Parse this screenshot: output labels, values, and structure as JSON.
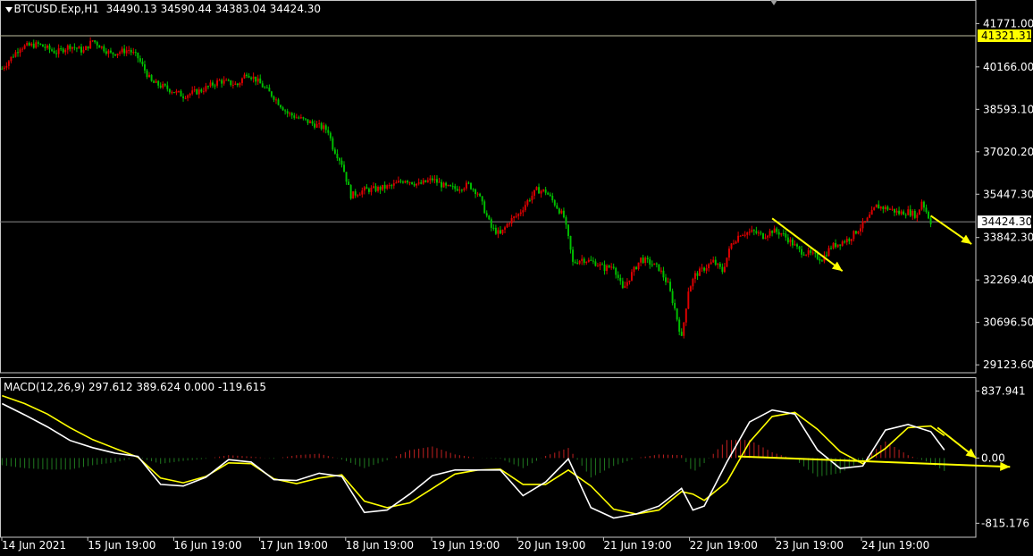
{
  "header": {
    "symbol": "BTCUSD.Exp,H1",
    "ohlc": "34490.13 34590.44 34383.04 34424.30"
  },
  "indicator": {
    "label": "MACD(12,26,9) 297.612 389.624 0.000 -119.615"
  },
  "colors": {
    "background": "#000000",
    "bull": "#00c000",
    "bear": "#e00000",
    "arrow": "#ffff00",
    "signal": "#ffff00",
    "macd": "#ffffff",
    "hist_pos": "#c02020",
    "hist_neg": "#207a20",
    "price_tag": "#ffff00"
  },
  "chart_data": [
    {
      "type": "candlestick",
      "symbol": "BTCUSD.Exp",
      "timeframe": "H1",
      "y_ticks": [
        41771.0,
        40166.0,
        38593.1,
        37020.2,
        35447.3,
        33842.3,
        32269.4,
        30696.5,
        29123.6
      ],
      "ylim": [
        28830,
        41950
      ],
      "price_labels": [
        "41321.31",
        "34424.30"
      ],
      "current_price": 34424.3,
      "upper_line": 41321.31,
      "x_tick_labels": [
        "14 Jun 2021",
        "15 Jun 19:00",
        "16 Jun 19:00",
        "17 Jun 19:00",
        "18 Jun 19:00",
        "19 Jun 19:00",
        "20 Jun 19:00",
        "21 Jun 19:00",
        "22 Jun 19:00",
        "23 Jun 19:00",
        "24 Jun 19:00"
      ],
      "close_path": [
        [
          0,
          40100
        ],
        [
          8,
          40900
        ],
        [
          16,
          41000
        ],
        [
          24,
          40700
        ],
        [
          30,
          40950
        ],
        [
          36,
          40750
        ],
        [
          40,
          41150
        ],
        [
          48,
          40650
        ],
        [
          56,
          40800
        ],
        [
          60,
          40500
        ],
        [
          66,
          39600
        ],
        [
          72,
          39400
        ],
        [
          80,
          39100
        ],
        [
          88,
          39300
        ],
        [
          96,
          39650
        ],
        [
          104,
          39500
        ],
        [
          108,
          39950
        ],
        [
          112,
          39700
        ],
        [
          120,
          39050
        ],
        [
          126,
          38450
        ],
        [
          130,
          38300
        ],
        [
          136,
          38100
        ],
        [
          142,
          37900
        ],
        [
          144,
          37800
        ],
        [
          146,
          37200
        ],
        [
          150,
          36600
        ],
        [
          154,
          35400
        ],
        [
          160,
          35600
        ],
        [
          166,
          35650
        ],
        [
          172,
          35750
        ],
        [
          178,
          36000
        ],
        [
          184,
          35800
        ],
        [
          190,
          36000
        ],
        [
          196,
          35700
        ],
        [
          200,
          35650
        ],
        [
          206,
          35800
        ],
        [
          210,
          35500
        ],
        [
          216,
          34200
        ],
        [
          220,
          33950
        ],
        [
          224,
          34450
        ],
        [
          228,
          34700
        ],
        [
          232,
          35200
        ],
        [
          236,
          35600
        ],
        [
          240,
          35550
        ],
        [
          244,
          35100
        ],
        [
          248,
          34600
        ],
        [
          250,
          33800
        ],
        [
          252,
          32900
        ],
        [
          256,
          33050
        ],
        [
          262,
          32900
        ],
        [
          266,
          32700
        ],
        [
          270,
          32800
        ],
        [
          274,
          31900
        ],
        [
          278,
          32500
        ],
        [
          282,
          33050
        ],
        [
          286,
          32900
        ],
        [
          290,
          32700
        ],
        [
          294,
          32100
        ],
        [
          297,
          31200
        ],
        [
          300,
          30100
        ],
        [
          303,
          31900
        ],
        [
          306,
          32450
        ],
        [
          310,
          32700
        ],
        [
          314,
          32950
        ],
        [
          318,
          32600
        ],
        [
          322,
          33600
        ],
        [
          326,
          34000
        ],
        [
          332,
          34050
        ],
        [
          336,
          33900
        ],
        [
          340,
          34100
        ],
        [
          344,
          34000
        ],
        [
          348,
          33700
        ],
        [
          352,
          33350
        ],
        [
          356,
          33250
        ],
        [
          362,
          33050
        ],
        [
          366,
          33500
        ],
        [
          370,
          33650
        ],
        [
          374,
          33800
        ],
        [
          378,
          34150
        ],
        [
          382,
          34500
        ],
        [
          386,
          35000
        ],
        [
          392,
          34900
        ],
        [
          396,
          34750
        ],
        [
          400,
          34800
        ],
        [
          404,
          34650
        ],
        [
          406,
          35200
        ],
        [
          410,
          34424.3
        ]
      ],
      "arrows": [
        {
          "from": [
            340,
            34550
          ],
          "to": [
            371,
            32600
          ]
        },
        {
          "from": [
            410,
            34650
          ],
          "to": [
            428,
            33600
          ]
        }
      ]
    },
    {
      "type": "macd",
      "params": [
        12,
        26,
        9
      ],
      "name": "MACD(12,26,9)",
      "values_shown": [
        297.612,
        389.624,
        0.0,
        -119.615
      ],
      "y_ticks": [
        837.941,
        0.0,
        -815.176
      ],
      "ylim": [
        -990,
        1010
      ],
      "macd": [
        [
          0,
          680
        ],
        [
          10,
          540
        ],
        [
          20,
          390
        ],
        [
          30,
          220
        ],
        [
          40,
          130
        ],
        [
          50,
          60
        ],
        [
          60,
          20
        ],
        [
          70,
          -330
        ],
        [
          80,
          -350
        ],
        [
          90,
          -240
        ],
        [
          100,
          -20
        ],
        [
          110,
          -50
        ],
        [
          120,
          -270
        ],
        [
          130,
          -280
        ],
        [
          140,
          -190
        ],
        [
          150,
          -230
        ],
        [
          160,
          -680
        ],
        [
          170,
          -650
        ],
        [
          180,
          -450
        ],
        [
          190,
          -220
        ],
        [
          200,
          -150
        ],
        [
          210,
          -150
        ],
        [
          220,
          -150
        ],
        [
          230,
          -470
        ],
        [
          240,
          -300
        ],
        [
          250,
          -10
        ],
        [
          260,
          -620
        ],
        [
          270,
          -750
        ],
        [
          280,
          -700
        ],
        [
          290,
          -600
        ],
        [
          300,
          -380
        ],
        [
          305,
          -650
        ],
        [
          310,
          -600
        ],
        [
          320,
          -50
        ],
        [
          330,
          450
        ],
        [
          340,
          600
        ],
        [
          350,
          550
        ],
        [
          360,
          100
        ],
        [
          370,
          -130
        ],
        [
          380,
          -100
        ],
        [
          390,
          350
        ],
        [
          400,
          420
        ],
        [
          410,
          330
        ],
        [
          416,
          100
        ]
      ],
      "signal": [
        [
          0,
          780
        ],
        [
          10,
          680
        ],
        [
          20,
          550
        ],
        [
          30,
          380
        ],
        [
          40,
          230
        ],
        [
          50,
          120
        ],
        [
          60,
          10
        ],
        [
          70,
          -250
        ],
        [
          80,
          -310
        ],
        [
          90,
          -230
        ],
        [
          100,
          -60
        ],
        [
          110,
          -70
        ],
        [
          120,
          -260
        ],
        [
          130,
          -320
        ],
        [
          140,
          -250
        ],
        [
          150,
          -210
        ],
        [
          160,
          -540
        ],
        [
          170,
          -620
        ],
        [
          180,
          -560
        ],
        [
          190,
          -380
        ],
        [
          200,
          -200
        ],
        [
          210,
          -150
        ],
        [
          220,
          -140
        ],
        [
          230,
          -330
        ],
        [
          240,
          -330
        ],
        [
          250,
          -150
        ],
        [
          260,
          -350
        ],
        [
          270,
          -640
        ],
        [
          280,
          -700
        ],
        [
          290,
          -650
        ],
        [
          300,
          -420
        ],
        [
          305,
          -450
        ],
        [
          310,
          -530
        ],
        [
          320,
          -300
        ],
        [
          330,
          200
        ],
        [
          340,
          520
        ],
        [
          350,
          570
        ],
        [
          360,
          360
        ],
        [
          370,
          80
        ],
        [
          380,
          -70
        ],
        [
          390,
          120
        ],
        [
          400,
          380
        ],
        [
          410,
          400
        ],
        [
          416,
          280
        ]
      ],
      "arrows": [
        {
          "from": [
            413,
            380
          ],
          "to": [
            430,
            0
          ]
        },
        {
          "from": [
            325,
            20
          ],
          "to": [
            445,
            -110
          ]
        }
      ]
    }
  ]
}
